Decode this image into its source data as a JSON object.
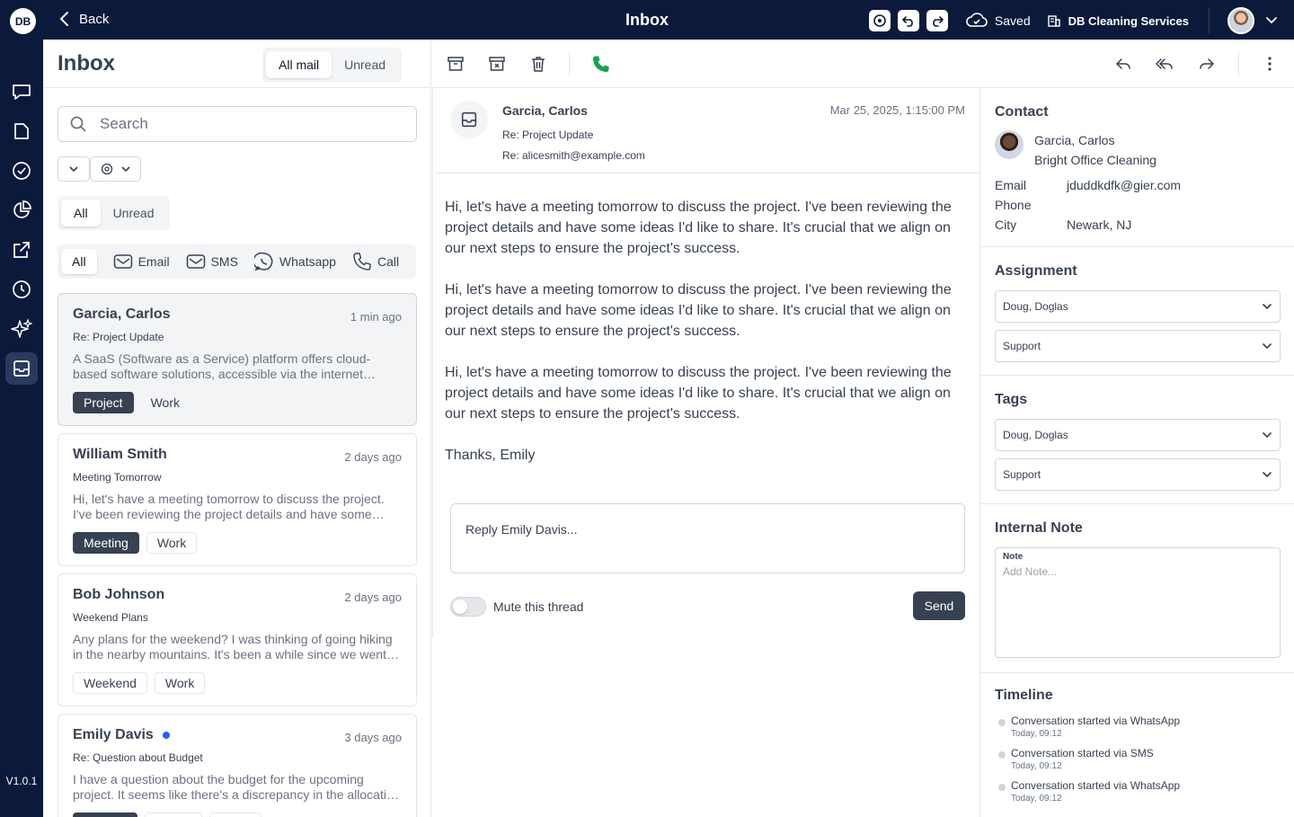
{
  "topbar": {
    "logo": "DB",
    "back_label": "Back",
    "title": "Inbox",
    "saved_label": "Saved",
    "company": "DB Cleaning Services"
  },
  "nav": {
    "version": "V1.0.1"
  },
  "list": {
    "title": "Inbox",
    "mail_filter": [
      "All mail",
      "Unread"
    ],
    "search_placeholder": "Search",
    "read_filter": [
      "All",
      "Unread"
    ],
    "channels": [
      "All",
      "Email",
      "SMS",
      "Whatsapp",
      "Call"
    ],
    "items": [
      {
        "name": "Garcia, Carlos",
        "time": "1 min ago",
        "subject": "Re: Project Update",
        "preview": "A SaaS (Software as a Service) platform offers cloud-based software solutions, accessible via the internet without installation on local devices.",
        "tags": [
          "Project",
          "Work"
        ]
      },
      {
        "name": "William Smith",
        "time": "2 days ago",
        "subject": "Meeting Tomorrow",
        "preview": "Hi, let's have a meeting tomorrow to discuss the project. I've been reviewing the project details and have some ideas I'd like to share.",
        "tags": [
          "Meeting",
          "Work"
        ]
      },
      {
        "name": "Bob Johnson",
        "time": "2 days ago",
        "subject": "Weekend Plans",
        "preview": "Any plans for the weekend? I was thinking of going hiking in the nearby mountains. It's been a while since we went out together.",
        "tags": [
          "Weekend",
          "Work"
        ]
      },
      {
        "name": "Emily Davis",
        "time": "3 days ago",
        "subject": "Re: Question about Budget",
        "preview": "I have a question about the budget for the upcoming project. It seems like there's a discrepancy in the allocation of resources.",
        "tags": []
      }
    ]
  },
  "message": {
    "sender": "Garcia, Carlos",
    "date": "Mar 25, 2025, 1:15:00 PM",
    "subject": "Re: Project Update",
    "to": "Re: alicesmith@example.com",
    "paragraphs": [
      "Hi, let's have a meeting tomorrow to discuss the project. I've been reviewing the project details and have some ideas I'd like to share. It's crucial that we align on our next steps to ensure the project's success.",
      "Hi, let's have a meeting tomorrow to discuss the project. I've been reviewing the project details and have some ideas I'd like to share. It's crucial that we align on our next steps to ensure the project's success.",
      "Hi, let's have a meeting tomorrow to discuss the project. I've been reviewing the project details and have some ideas I'd like to share. It's crucial that we align on our next steps to ensure the project's success.",
      "Thanks, Emily"
    ],
    "reply_placeholder": "Reply Emily Davis...",
    "mute_label": "Mute this thread",
    "send_label": "Send"
  },
  "contact": {
    "title": "Contact",
    "name": "Garcia, Carlos",
    "company": "Bright Office Cleaning",
    "email_label": "Email",
    "email": "jduddkdfk@gier.com",
    "phone_label": "Phone",
    "phone": "",
    "city_label": "City",
    "city": "Newark, NJ"
  },
  "assignment": {
    "title": "Assignment",
    "user": "Doug, Doglas",
    "team": "Support"
  },
  "tags_section": {
    "title": "Tags",
    "user": "Doug, Doglas",
    "team": "Support"
  },
  "internal_note": {
    "title": "Internal Note",
    "label": "Note",
    "placeholder": "Add Note..."
  },
  "timeline": {
    "title": "Timeline",
    "items": [
      {
        "text": "Conversation started via WhatsApp",
        "time": "Today, 09:12"
      },
      {
        "text": "Conversation started via SMS",
        "time": "Today, 09:12"
      },
      {
        "text": "Conversation started via WhatsApp",
        "time": "Today, 09:12"
      }
    ]
  }
}
